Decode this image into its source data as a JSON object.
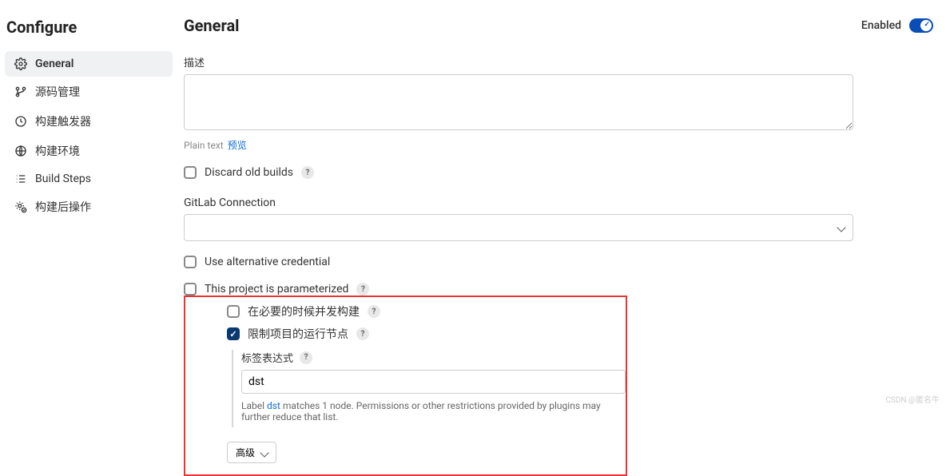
{
  "sidebar": {
    "title": "Configure",
    "items": [
      {
        "label": "General",
        "icon": "gear-icon"
      },
      {
        "label": "源码管理",
        "icon": "branch-icon"
      },
      {
        "label": "构建触发器",
        "icon": "clock-icon"
      },
      {
        "label": "构建环境",
        "icon": "globe-icon"
      },
      {
        "label": "Build Steps",
        "icon": "list-icon"
      },
      {
        "label": "构建后操作",
        "icon": "gear-badge-icon"
      }
    ]
  },
  "header": {
    "title": "General",
    "enabled_label": "Enabled"
  },
  "general": {
    "description_label": "描述",
    "plaintext_label": "Plain text",
    "preview_label": "预览",
    "discard_old_builds": "Discard old builds",
    "gitlab_connection_label": "GitLab Connection",
    "gitlab_connection_value": "",
    "use_alternative_credential": "Use alternative credential",
    "parameterized": "This project is parameterized",
    "concurrent_build": "在必要的时候并发构建",
    "restrict_node": "限制项目的运行节点",
    "label_expr_label": "标签表达式",
    "label_expr_value": "dst",
    "label_hint_prefix": "Label ",
    "label_hint_name": "dst",
    "label_hint_suffix": " matches 1 node. Permissions or other restrictions provided by plugins may further reduce that list.",
    "advanced_btn": "高级"
  },
  "watermark": "CSDN @匿名牛"
}
